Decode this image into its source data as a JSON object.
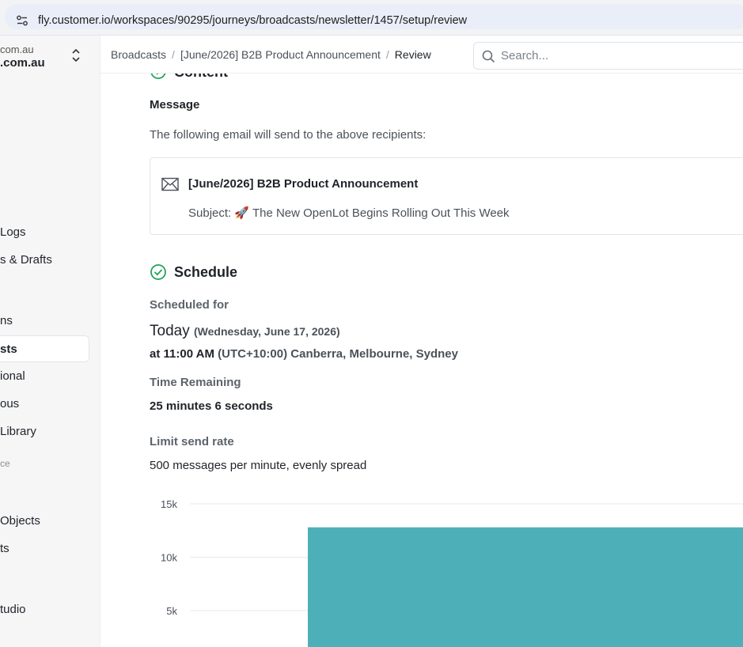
{
  "browser": {
    "url": "fly.customer.io/workspaces/90295/journeys/broadcasts/newsletter/1457/setup/review"
  },
  "sidebar": {
    "workspace_domain": "com.au",
    "workspace_name": ".com.au",
    "items": [
      {
        "label": "Logs"
      },
      {
        "label": "s & Drafts"
      },
      {
        "label": "ns"
      },
      {
        "label": "sts",
        "active": true
      },
      {
        "label": "ional"
      },
      {
        "label": "ous"
      },
      {
        "label": "Library"
      },
      {
        "label": "Objects"
      },
      {
        "label": "ts"
      },
      {
        "label": "tudio"
      }
    ],
    "section_heading": "ce"
  },
  "topbar": {
    "breadcrumb": [
      "Broadcasts",
      "[June/2026] B2B Product Announcement",
      "Review"
    ],
    "search_placeholder": "Search..."
  },
  "content_section": {
    "title": "Content",
    "message_label": "Message",
    "intro": "The following email will send to the above recipients:",
    "email": {
      "name": "[June/2026] B2B Product Announcement",
      "subject": "Subject: 🚀 The New OpenLot Begins Rolling Out This Week"
    }
  },
  "schedule_section": {
    "title": "Schedule",
    "scheduled_for_label": "Scheduled for",
    "day": "Today",
    "date": "(Wednesday, June 17, 2026)",
    "time": "at 11:00 AM",
    "timezone": "(UTC+10:00) Canberra, Melbourne, Sydney",
    "time_remaining_label": "Time Remaining",
    "time_remaining": "25 minutes 6 seconds",
    "limit_label": "Limit send rate",
    "limit_value": "500 messages per minute, evenly spread"
  },
  "chart_data": {
    "type": "bar",
    "y_ticks": [
      "15k",
      "10k",
      "5k"
    ],
    "ylim": [
      0,
      15000
    ],
    "series": [
      {
        "values": [
          12800
        ]
      }
    ],
    "bar_color": "#4db0b8",
    "grid": true
  },
  "colors": {
    "success": "#22a35a",
    "bar": "#4db0b8"
  }
}
